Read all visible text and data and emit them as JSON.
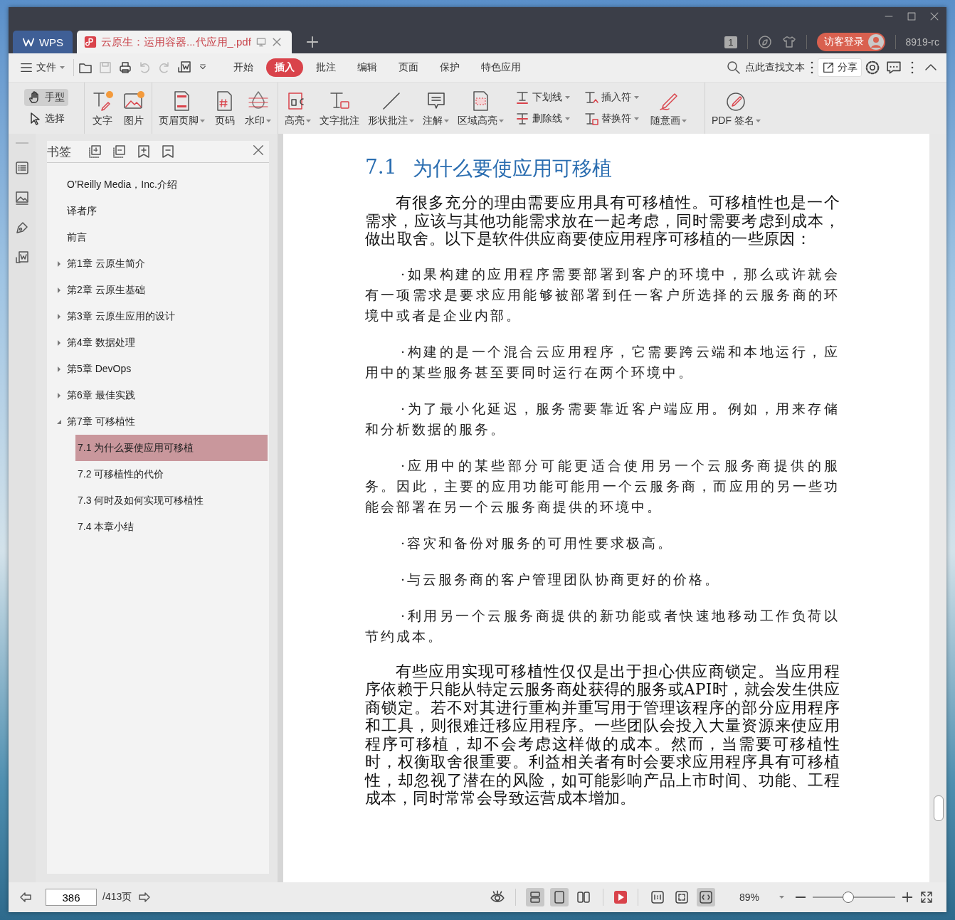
{
  "titlebar": {
    "tabs": [
      {
        "label": "WPS",
        "kind": "home",
        "selected": false
      },
      {
        "label": "云原生：运用容器...代应用_.pdf",
        "kind": "document",
        "selected": true
      }
    ],
    "window_count": "1",
    "login": "访客登录",
    "user": "8919-rc"
  },
  "menubar": {
    "file": "文件",
    "tabs": [
      {
        "label": "开始",
        "selected": false
      },
      {
        "label": "插入",
        "selected": true
      },
      {
        "label": "批注",
        "selected": false
      },
      {
        "label": "编辑",
        "selected": false
      },
      {
        "label": "页面",
        "selected": false
      },
      {
        "label": "保护",
        "selected": false
      },
      {
        "label": "特色应用",
        "selected": false
      }
    ],
    "search": "点此查找文本",
    "share": "分享"
  },
  "ribbon": [
    {
      "items": [
        {
          "kind": "stack",
          "items": [
            {
              "label": "手型",
              "dropdown": false,
              "selected": true
            },
            {
              "label": "选择",
              "dropdown": false,
              "selected": false
            }
          ]
        }
      ]
    },
    {
      "items": [
        {
          "kind": "large",
          "label": "文字",
          "dropdown": false
        },
        {
          "kind": "large",
          "label": "图片",
          "dropdown": false
        }
      ]
    },
    {
      "items": [
        {
          "kind": "large",
          "label": "页眉页脚",
          "dropdown": true
        },
        {
          "kind": "large",
          "label": "页码",
          "dropdown": false
        },
        {
          "kind": "large",
          "label": "水印",
          "dropdown": true
        }
      ]
    },
    {
      "items": [
        {
          "kind": "large",
          "label": "高亮",
          "dropdown": true
        },
        {
          "kind": "large",
          "label": "文字批注",
          "dropdown": false
        },
        {
          "kind": "large",
          "label": "形状批注",
          "dropdown": true
        },
        {
          "kind": "large",
          "label": "注解",
          "dropdown": true
        },
        {
          "kind": "large",
          "label": "区域高亮",
          "dropdown": true
        },
        {
          "kind": "stack",
          "items": [
            {
              "label": "下划线",
              "dropdown": true,
              "selected": false
            },
            {
              "label": "删除线",
              "dropdown": true,
              "selected": false
            }
          ]
        },
        {
          "kind": "stack",
          "items": [
            {
              "label": "插入符",
              "dropdown": true,
              "selected": false
            },
            {
              "label": "替换符",
              "dropdown": true,
              "selected": false
            }
          ]
        },
        {
          "kind": "large",
          "label": "随意画",
          "dropdown": true
        }
      ]
    },
    {
      "items": [
        {
          "kind": "large",
          "label": "PDF 签名",
          "dropdown": true
        }
      ]
    }
  ],
  "sidebar": {
    "title": "书签",
    "bookmarks": [
      {
        "label": "O’Reilly Media，Inc.介绍",
        "selected": false
      },
      {
        "label": "译者序",
        "selected": false
      },
      {
        "label": "前言",
        "selected": false
      },
      {
        "label": "第1章 云原生简介",
        "expanded": false,
        "selected": false
      },
      {
        "label": "第2章 云原生基础",
        "expanded": false,
        "selected": false
      },
      {
        "label": "第3章 云原生应用的设计",
        "expanded": false,
        "selected": false
      },
      {
        "label": "第4章 数据处理",
        "expanded": false,
        "selected": false
      },
      {
        "label": "第5章 DevOps",
        "expanded": false,
        "selected": false
      },
      {
        "label": "第6章 最佳实践",
        "expanded": false,
        "selected": false
      },
      {
        "label": "第7章 可移植性",
        "expanded": true,
        "selected": false,
        "children": [
          {
            "label": "7.1 为什么要使应用可移植",
            "selected": true
          },
          {
            "label": "7.2 可移植性的代价",
            "selected": false
          },
          {
            "label": "7.3 何时及如何实现可移植性",
            "selected": false
          },
          {
            "label": "7.4 本章小结",
            "selected": false
          }
        ]
      }
    ]
  },
  "document": {
    "heading_number": "7.1",
    "heading": "为什么要使应用可移植",
    "blocks": [
      {
        "kind": "body",
        "text": "有很多充分的理由需要应用具有可移植性。可移植性也是一个需求，应该与其他功能需求放在一起考虑，同时需要考虑到成本，做出取舍。以下是软件供应商要使应用程序可移植的一些原因："
      },
      {
        "kind": "bullet",
        "text": "·如果构建的应用程序需要部署到客户的环境中，那么或许就会有一项需求是要求应用能够被部署到任一客户所选择的云服务商的环境中或者是企业内部。"
      },
      {
        "kind": "bullet",
        "text": "·构建的是一个混合云应用程序，它需要跨云端和本地运行，应用中的某些服务甚至要同时运行在两个环境中。"
      },
      {
        "kind": "bullet",
        "text": "·为了最小化延迟，服务需要靠近客户端应用。例如，用来存储和分析数据的服务。"
      },
      {
        "kind": "bullet",
        "text": "·应用中的某些部分可能更适合使用另一个云服务商提供的服务。因此，主要的应用功能可能用一个云服务商，而应用的另一些功能会部署在另一个云服务商提供的环境中。"
      },
      {
        "kind": "bullet",
        "text": "·容灾和备份对服务的可用性要求极高。"
      },
      {
        "kind": "bullet",
        "text": "·与云服务商的客户管理团队协商更好的价格。"
      },
      {
        "kind": "bullet",
        "text": "·利用另一个云服务商提供的新功能或者快速地移动工作负荷以节约成本。"
      },
      {
        "kind": "body",
        "text": "有些应用实现可移植性仅仅是出于担心供应商锁定。当应用程序依赖于只能从特定云服务商处获得的服务或API时，就会发生供应商锁定。若不对其进行重构并重写用于管理该程序的部分应用程序和工具，则很难迁移应用程序。一些团队会投入大量资源来使应用程序可移植，却不会考虑这样做的成本。然而，当需要可移植性时，权衡取舍很重要。利益相关者有时会要求应用程序具有可移植性，却忽视了潜在的风险，如可能影响产品上市时间、功能、工程成本，同时常常会导致运营成本增加。"
      }
    ]
  },
  "statusbar": {
    "page": "386",
    "page_total": "/413页",
    "view_modes": [
      {
        "selected": true
      },
      {
        "selected": true
      },
      {
        "selected": false
      }
    ],
    "fit_modes": [
      {
        "selected": false
      },
      {
        "selected": false
      },
      {
        "selected": true
      }
    ],
    "zoom": "89%",
    "zoom_slider": {
      "level": 0.43
    }
  }
}
